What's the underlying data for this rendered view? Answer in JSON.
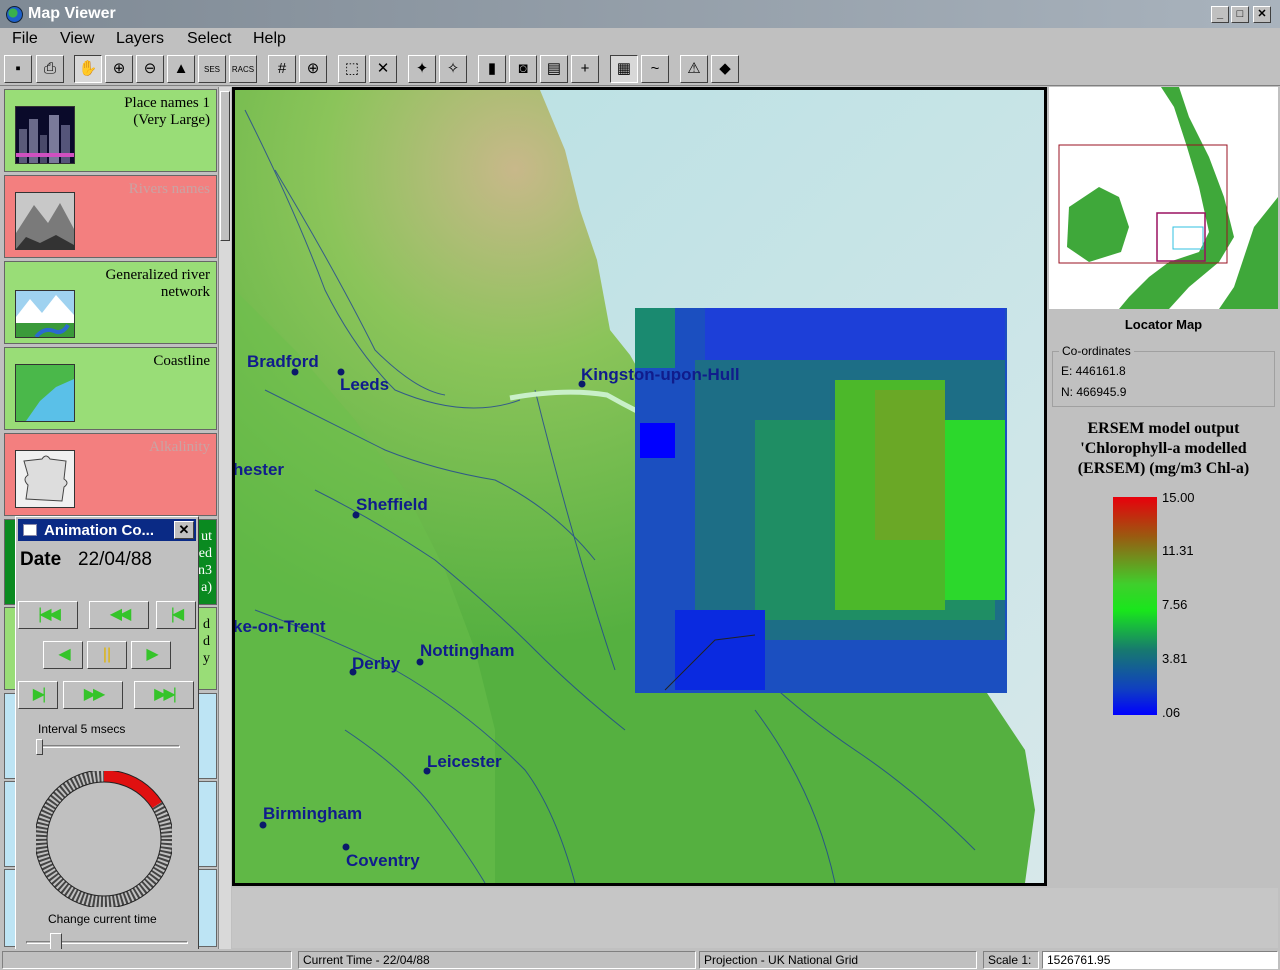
{
  "window": {
    "title": "Map Viewer"
  },
  "menu": [
    "File",
    "View",
    "Layers",
    "Select",
    "Help"
  ],
  "toolbar": {
    "icons": [
      "save-icon",
      "print-icon",
      "pan-hand-icon",
      "zoom-in-icon",
      "zoom-out-icon",
      "fit-view-icon",
      "ses-icon",
      "racs-icon",
      "grid-icon",
      "globe-icon",
      "select-icon",
      "deselect-icon",
      "magic-wand-icon",
      "magic-wand-2-icon",
      "bar-chart-icon",
      "camera-icon",
      "film-icon",
      "measure-icon",
      "raster-icon",
      "profile-icon",
      "warning-icon",
      "eraser-icon"
    ],
    "ses_label": "SES",
    "racs_label": "RACS"
  },
  "layers": [
    {
      "name": "Place names 1\n(Very Large)",
      "state": "on",
      "thumb": "city-thumb"
    },
    {
      "name": "Rivers names",
      "state": "off",
      "thumb": "mountain-thumb"
    },
    {
      "name": "Generalized river\nnetwork",
      "state": "on",
      "thumb": "river-thumb"
    },
    {
      "name": "Coastline",
      "state": "on",
      "thumb": "coast-thumb"
    },
    {
      "name": "Alkalinity",
      "state": "off",
      "thumb": "puzzle-thumb"
    }
  ],
  "map": {
    "places": [
      "Bradford",
      "Leeds",
      "Kingston-upon-Hull",
      "hester",
      "Sheffield",
      "ke-on-Trent",
      "Derby",
      "Nottingham",
      "Leicester",
      "Birmingham",
      "Coventry"
    ]
  },
  "locator": {
    "label": "Locator Map"
  },
  "coords": {
    "legend": "Co-ordinates",
    "e": "E: 446161.8",
    "n": "N: 466945.9"
  },
  "legend": {
    "title_1": "ERSEM model output",
    "title_2": "'Chlorophyll-a modelled",
    "title_3": "(ERSEM) (mg/m3 Chl-a)",
    "values": [
      "15.00",
      "11.31",
      "7.56",
      "3.81",
      ".06"
    ]
  },
  "animation": {
    "title": "Animation Co...",
    "date_label": "Date",
    "date_value": "22/04/88",
    "interval_label": "Interval 5 msecs",
    "time_label": "Change current time",
    "partial_right": "ut\ned\nn3\na)",
    "partial_right2": "d\nd\ny"
  },
  "status": {
    "current_time": "Current Time - 22/04/88",
    "projection": "Projection - UK National Grid",
    "scale_label": "Scale 1:",
    "scale_value": "1526761.95"
  }
}
